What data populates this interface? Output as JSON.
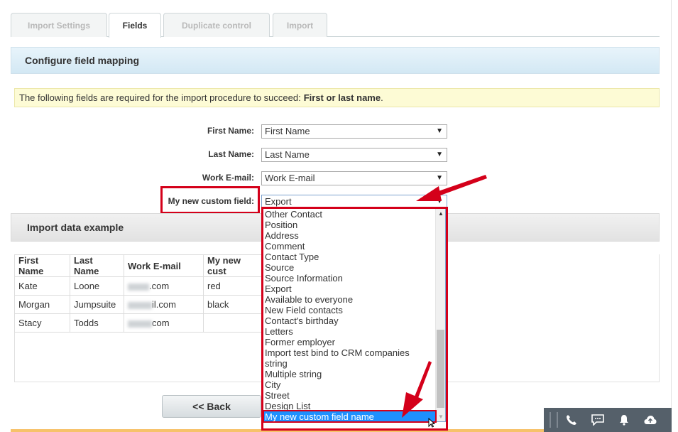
{
  "tabs": [
    {
      "label": "Import Settings",
      "active": false
    },
    {
      "label": "Fields",
      "active": true
    },
    {
      "label": "Duplicate control",
      "active": false
    },
    {
      "label": "Import",
      "active": false
    }
  ],
  "mapping_section": {
    "title": "Configure field mapping"
  },
  "notice": {
    "text": "The following fields are required for the import procedure to succeed:",
    "required": "First or last name",
    "suffix": "."
  },
  "fields": [
    {
      "label": "First Name:",
      "value": "First Name"
    },
    {
      "label": "Last Name:",
      "value": "Last Name"
    },
    {
      "label": "Work E-mail:",
      "value": "Work E-mail"
    },
    {
      "label": "My new custom field:",
      "value": "Export"
    }
  ],
  "example_section": {
    "title": "Import data example"
  },
  "table": {
    "columns": [
      "First Name",
      "Last Name",
      "Work E-mail",
      "My new cust"
    ],
    "rows": [
      {
        "first": "Kate",
        "last": "Loone",
        "email_suffix": ".com",
        "custom": "red"
      },
      {
        "first": "Morgan",
        "last": "Jumpsuite",
        "email_suffix": "il.com",
        "custom": "black"
      },
      {
        "first": "Stacy",
        "last": "Todds",
        "email_suffix": "com",
        "custom": ""
      }
    ]
  },
  "dropdown": {
    "options": [
      "Other Contact",
      "Position",
      "Address",
      "Comment",
      "Contact Type",
      "Source",
      "Source Information",
      "Export",
      "Available to everyone",
      "New Field contacts",
      "Contact's birthday",
      "Letters",
      "Former employer",
      "Import test bind to CRM companies",
      "string",
      "Multiple string",
      "City",
      "Street",
      "Design List",
      "My new custom field name"
    ],
    "selected": "My new custom field name"
  },
  "buttons": {
    "back": "<< Back"
  },
  "toolbar": {
    "icons": [
      "phone-icon",
      "chat-icon",
      "bell-icon",
      "cloud-upload-icon"
    ]
  },
  "colors": {
    "annotation_red": "#d4001a",
    "selected_option": "#1e90ff",
    "toolbar_bg": "#55606a"
  }
}
